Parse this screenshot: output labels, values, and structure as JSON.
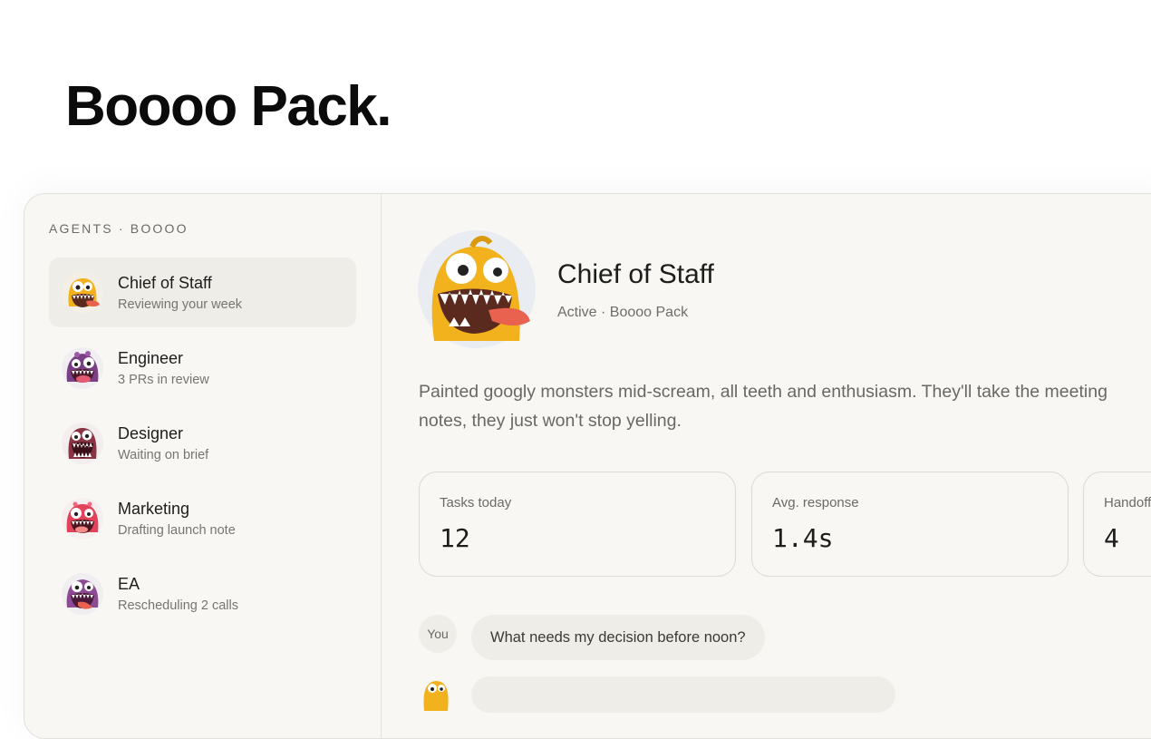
{
  "page": {
    "title": "Boooo Pack."
  },
  "sidebar": {
    "heading": "AGENTS · BOOOO",
    "agents": [
      {
        "name": "Chief of Staff",
        "status": "Reviewing your week",
        "color": "#f2b21e",
        "active": true
      },
      {
        "name": "Engineer",
        "status": "3 PRs in review",
        "color": "#7a3f86",
        "active": false
      },
      {
        "name": "Designer",
        "status": "Waiting on brief",
        "color": "#8a3343",
        "active": false
      },
      {
        "name": "Marketing",
        "status": "Drafting launch note",
        "color": "#e2435a",
        "active": false
      },
      {
        "name": "EA",
        "status": "Rescheduling 2 calls",
        "color": "#8c4b93",
        "active": false
      }
    ]
  },
  "profile": {
    "name": "Chief of Staff",
    "meta": "Active · Boooo Pack",
    "description": "Painted googly monsters mid-scream, all teeth and enthusiasm. They'll take the meeting notes, they just won't stop yelling."
  },
  "stats": [
    {
      "label": "Tasks today",
      "value": "12"
    },
    {
      "label": "Avg. response",
      "value": "1.4s"
    },
    {
      "label": "Handoff",
      "value": "4"
    }
  ],
  "chat": {
    "you_label": "You",
    "message": "What needs my decision before noon?"
  }
}
